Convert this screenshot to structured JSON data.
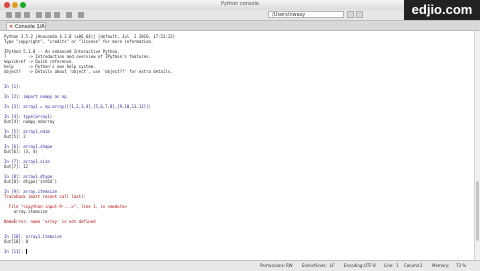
{
  "window": {
    "title": "Python console"
  },
  "toolbar": {
    "path": "/Users/nwasy"
  },
  "tabs": [
    {
      "label": "Console 1/A"
    }
  ],
  "logo": {
    "text": "edjio.com"
  },
  "console": {
    "lines": [
      "Python 3.5.2 |Anaconda 4.2.0 (x86_64)| (default, Jul  2 2016, 17:52:12)",
      "Type \"copyright\", \"credits\" or \"license\" for more information.",
      "",
      "IPython 5.1.0 -- An enhanced Interactive Python.",
      "?         -> Introduction and overview of IPython's features.",
      "%quickref -> Quick reference.",
      "help      -> Python's own help system.",
      "object?   -> Details about 'object', use 'object??' for extra details.",
      "",
      "",
      "In [1]:",
      "",
      "In [2]: import numpy as np",
      "",
      "In [3]: array1 = np.array([[1,2,3,4],[5,6,7,8],[9,10,11,12]])",
      "",
      "In [4]: type(array1)",
      "Out[4]: numpy.ndarray",
      "",
      "In [5]: array1.ndim",
      "Out[5]: 2",
      "",
      "In [6]: array1.shape",
      "Out[6]: (3, 4)",
      "",
      "In [7]: array1.size",
      "Out[7]: 12",
      "",
      "In [8]: array1.dtype",
      "Out[8]: dtype('int64')",
      "",
      "In [9]: array.itemsize",
      "Traceback (most recent call last):",
      "",
      "  File \"<ipython-input-9-...>\", line 1, in <module>",
      "    array.itemsize",
      "",
      "NameError: name 'array' is not defined",
      "",
      "",
      "In [10]: array1.itemsize",
      "Out[10]: 8",
      "",
      "In [11]:"
    ]
  },
  "status": {
    "permissions": "Permissions:",
    "permissions_value": "RW",
    "eol": "End-of-lines:",
    "eol_value": "LF",
    "encoding": "Encoding:",
    "encoding_value": "UTF-8",
    "line": "Line:",
    "line_value": "1",
    "col": "Column:",
    "col_value": "1",
    "memory": "Memory:",
    "memory_value": "73 %"
  }
}
